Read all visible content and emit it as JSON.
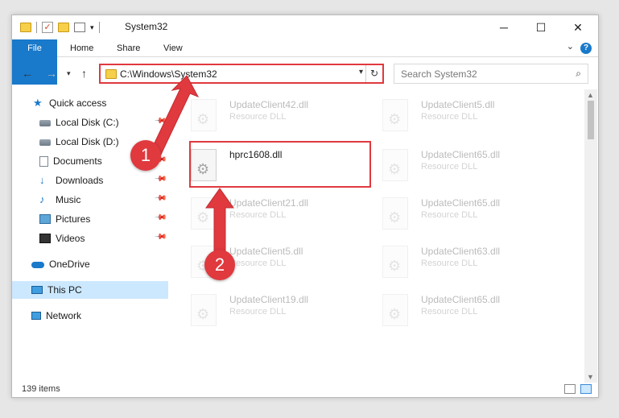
{
  "window": {
    "title": "System32",
    "caption": {
      "minimize": "─",
      "maximize": "☐",
      "close": "✕"
    }
  },
  "ribbon": {
    "tabs": [
      "File",
      "Home",
      "Share",
      "View"
    ],
    "help": "?"
  },
  "address": {
    "path": "C:\\Windows\\System32",
    "refresh": "↻"
  },
  "search": {
    "placeholder": "Search System32"
  },
  "nav": {
    "items": [
      {
        "label": "Quick access",
        "icon": "star-icon"
      },
      {
        "label": "Local Disk (C:)",
        "icon": "drive-icon"
      },
      {
        "label": "Local Disk (D:)",
        "icon": "drive-icon"
      },
      {
        "label": "Documents",
        "icon": "document-icon"
      },
      {
        "label": "Downloads",
        "icon": "download-icon"
      },
      {
        "label": "Music",
        "icon": "music-icon"
      },
      {
        "label": "Pictures",
        "icon": "pictures-icon"
      },
      {
        "label": "Videos",
        "icon": "videos-icon"
      },
      {
        "label": "OneDrive",
        "icon": "cloud-icon"
      },
      {
        "label": "This PC",
        "icon": "computer-icon"
      },
      {
        "label": "Network",
        "icon": "network-icon"
      }
    ]
  },
  "files": [
    {
      "name": "UpdateClient42.dll",
      "type": "Resource DLL"
    },
    {
      "name": "UpdateClient5.dll",
      "type": "Resource DLL"
    },
    {
      "name": "hprc1608.dll",
      "type": ""
    },
    {
      "name": "UpdateClient65.dll",
      "type": "Resource DLL"
    },
    {
      "name": "UpdateClient21.dll",
      "type": "Resource DLL"
    },
    {
      "name": "UpdateClient65.dll",
      "type": "Resource DLL"
    },
    {
      "name": "UpdateClient5.dll",
      "type": "Resource DLL"
    },
    {
      "name": "UpdateClient63.dll",
      "type": "Resource DLL"
    },
    {
      "name": "UpdateClient19.dll",
      "type": "Resource DLL"
    },
    {
      "name": "UpdateClient65.dll",
      "type": "Resource DLL"
    }
  ],
  "status": {
    "count": "139 items"
  },
  "callouts": [
    "1",
    "2"
  ],
  "colors": {
    "accent": "#1979ca",
    "highlight": "#e0393e",
    "selected": "#cce8ff"
  }
}
